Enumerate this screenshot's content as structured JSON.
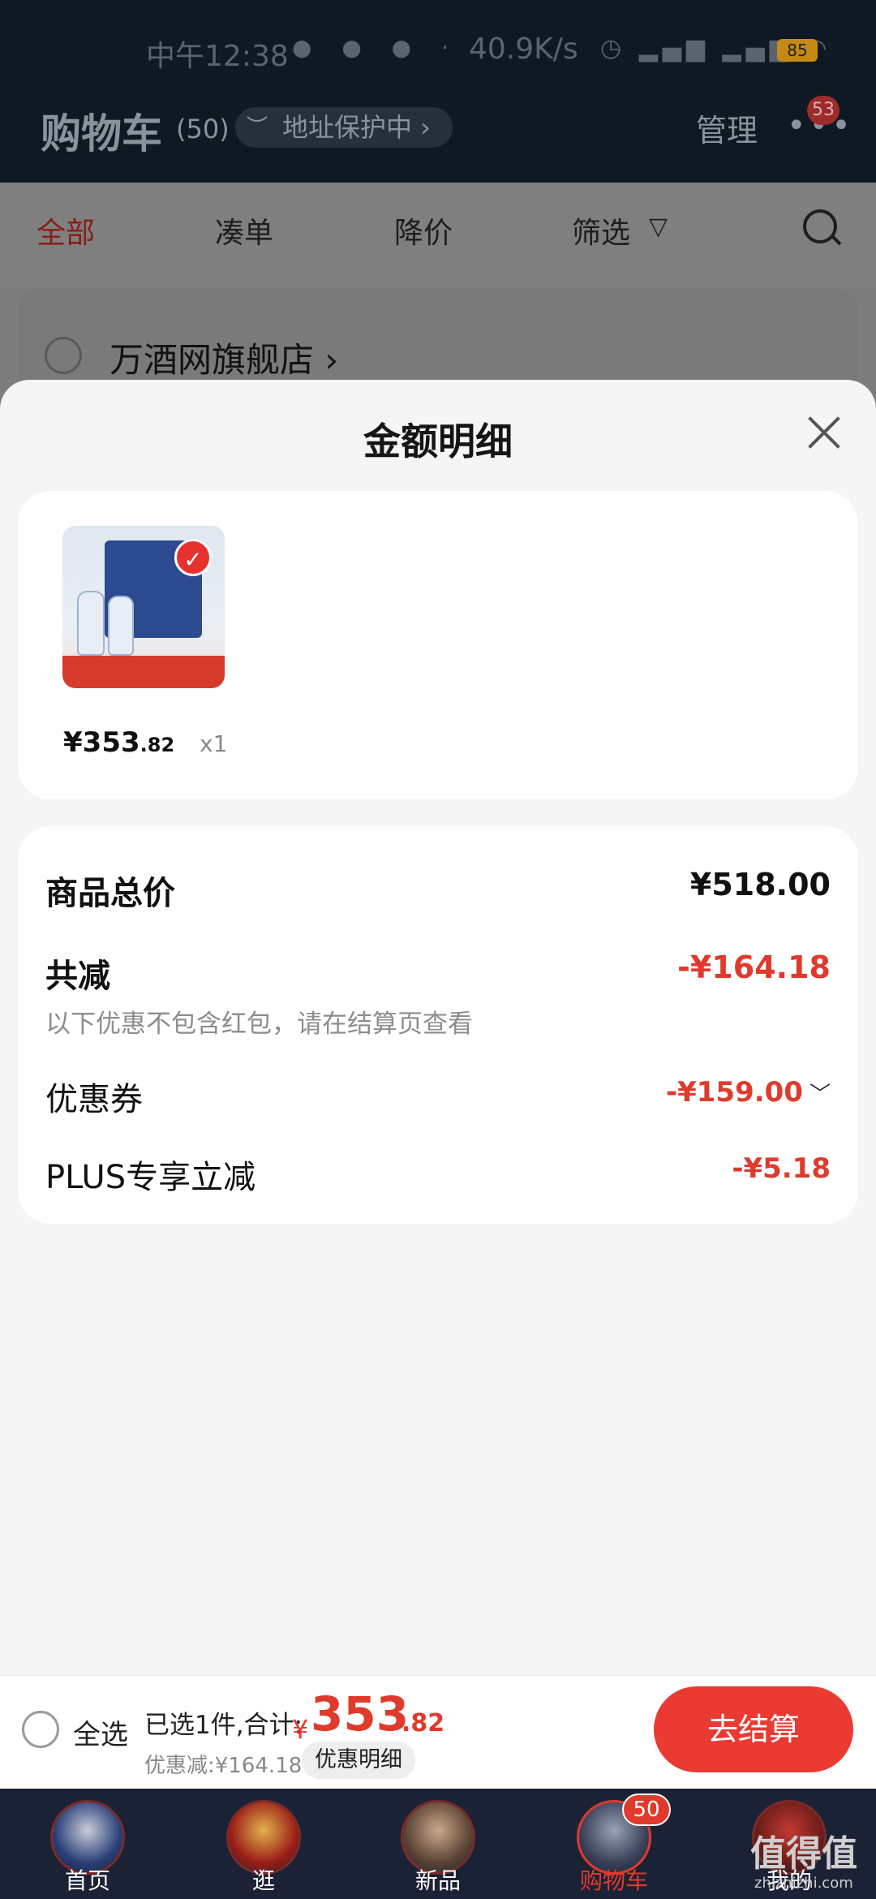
{
  "status_bar": {
    "time": "中午12:38",
    "net_speed": "40.9K/s",
    "battery": "85"
  },
  "header": {
    "title": "购物车",
    "count": "(50)",
    "address_pill": "地址保护中 ›",
    "manage": "管理",
    "more_badge": "53"
  },
  "tabs": {
    "all": "全部",
    "combine": "凑单",
    "price_drop": "降价",
    "filter": "筛选"
  },
  "store": {
    "name": "万酒网旗舰店 ›"
  },
  "sheet": {
    "title": "金额明细",
    "product": {
      "price_int": "¥353",
      "price_dec": ".82",
      "qty": "x1"
    },
    "rows": {
      "total_label": "商品总价",
      "total_value": "¥518.00",
      "reduce_label": "共减",
      "reduce_value": "-¥164.18",
      "note": "以下优惠不包含红包，请在结算页查看",
      "coupon_label": "优惠券",
      "coupon_value": "-¥159.00",
      "plus_label": "PLUS专享立减",
      "plus_value": "-¥5.18"
    }
  },
  "action_bar": {
    "select_all": "全选",
    "summary": "已选1件,合计:",
    "total_symbol": "¥",
    "total_int": "353",
    "total_dec": ".82",
    "discount": "优惠减:¥164.18",
    "detail_button": "优惠明细",
    "checkout": "去结算"
  },
  "bottom_nav": {
    "items": [
      {
        "label": "首页"
      },
      {
        "label": "逛"
      },
      {
        "label": "新品"
      },
      {
        "label": "购物车",
        "badge": "50"
      },
      {
        "label": "我的"
      }
    ],
    "watermark": "值得值",
    "watermark_sub": "zhizhizhi.com"
  },
  "colors": {
    "accent_red": "#e03a2c",
    "header_dark": "#0f1924",
    "nav_dark": "#1c2236"
  }
}
